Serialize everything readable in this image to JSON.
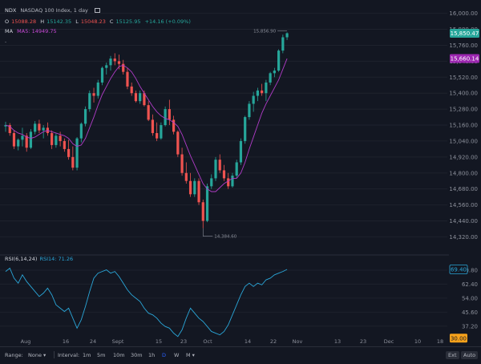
{
  "header": {
    "symbol": "NDX",
    "description": "NASDAQ 100 Index, 1 day",
    "o_label": "O",
    "o_value": "15088.28",
    "h_label": "H",
    "h_value": "15142.35",
    "l_label": "L",
    "l_value": "15048.23",
    "c_label": "C",
    "c_value": "15125.95",
    "change": "+14.16 (+0.09%)",
    "ma_label": "MA",
    "ma_value": "MA5: 14949.75"
  },
  "rsi_legend": {
    "label": "RSI(6,14,24)",
    "value": "RSI14: 71.26"
  },
  "bottom_bar": {
    "range_label": "Range:",
    "range_value": "None",
    "interval_label": "Interval:",
    "intervals": [
      "1m",
      "5m",
      "10m",
      "30m",
      "1h",
      "D",
      "W",
      "M"
    ],
    "active_interval": "D",
    "ext_label": "Ext",
    "auto_label": "Auto"
  },
  "chart_data": {
    "type": "candlestick",
    "price_axis": {
      "ticks": [
        16000,
        15880,
        15760,
        15640,
        15520,
        15400,
        15280,
        15160,
        15040,
        14920,
        14800,
        14680,
        14560,
        14440,
        14320
      ],
      "ylim": [
        14220,
        16040
      ]
    },
    "rsi_axis": {
      "ticks": [
        70.8,
        62.4,
        54,
        45.6,
        37.2
      ],
      "oversold": 30,
      "ylim": [
        27,
        78
      ]
    },
    "price_badges": {
      "last": "15,850.47",
      "ma": "15,660.14"
    },
    "annotations": {
      "high": "15,856.90",
      "low": "14,384.60"
    },
    "x_ticks": [
      "Aug",
      "16",
      "24",
      "Sept",
      "15",
      "23",
      "Oct",
      "14",
      "22",
      "Nov",
      "13",
      "23",
      "Dec",
      "10",
      "18"
    ],
    "candles": [
      [
        15150,
        15185,
        15110,
        15160
      ],
      [
        15160,
        15175,
        15080,
        15100
      ],
      [
        15100,
        15120,
        14980,
        15000
      ],
      [
        15000,
        15060,
        14970,
        15050
      ],
      [
        15050,
        15140,
        15000,
        15080
      ],
      [
        15080,
        15100,
        14960,
        14990
      ],
      [
        14990,
        15130,
        14980,
        15110
      ],
      [
        15110,
        15190,
        15090,
        15170
      ],
      [
        15170,
        15200,
        15100,
        15120
      ],
      [
        15120,
        15160,
        15060,
        15140
      ],
      [
        15140,
        15180,
        15080,
        15100
      ],
      [
        15100,
        15120,
        14980,
        15010
      ],
      [
        15010,
        15100,
        14990,
        15080
      ],
      [
        15080,
        15110,
        15000,
        15040
      ],
      [
        15040,
        15060,
        14960,
        14980
      ],
      [
        14980,
        15050,
        14900,
        14920
      ],
      [
        14920,
        15000,
        14820,
        14840
      ],
      [
        14840,
        15070,
        14820,
        15060
      ],
      [
        15060,
        15180,
        15030,
        15170
      ],
      [
        15170,
        15300,
        15150,
        15280
      ],
      [
        15280,
        15420,
        15260,
        15400
      ],
      [
        15400,
        15440,
        15330,
        15380
      ],
      [
        15380,
        15500,
        15360,
        15480
      ],
      [
        15480,
        15600,
        15460,
        15590
      ],
      [
        15590,
        15630,
        15540,
        15610
      ],
      [
        15610,
        15680,
        15570,
        15660
      ],
      [
        15660,
        15700,
        15610,
        15640
      ],
      [
        15640,
        15690,
        15580,
        15620
      ],
      [
        15620,
        15650,
        15540,
        15560
      ],
      [
        15560,
        15590,
        15430,
        15450
      ],
      [
        15450,
        15480,
        15380,
        15400
      ],
      [
        15400,
        15420,
        15330,
        15340
      ],
      [
        15340,
        15420,
        15320,
        15400
      ],
      [
        15400,
        15420,
        15300,
        15310
      ],
      [
        15310,
        15340,
        15190,
        15200
      ],
      [
        15200,
        15240,
        15080,
        15100
      ],
      [
        15100,
        15180,
        15040,
        15060
      ],
      [
        15060,
        15180,
        15050,
        15160
      ],
      [
        15160,
        15300,
        15150,
        15280
      ],
      [
        15280,
        15350,
        15160,
        15200
      ],
      [
        15200,
        15230,
        15090,
        15110
      ],
      [
        15110,
        15120,
        14920,
        14940
      ],
      [
        14940,
        14990,
        14780,
        14800
      ],
      [
        14800,
        14880,
        14720,
        14740
      ],
      [
        14740,
        14800,
        14620,
        14640
      ],
      [
        14640,
        14760,
        14620,
        14740
      ],
      [
        14740,
        14760,
        14560,
        14580
      ],
      [
        14580,
        14600,
        14384.6,
        14440
      ],
      [
        14440,
        14720,
        14430,
        14700
      ],
      [
        14700,
        14790,
        14680,
        14760
      ],
      [
        14760,
        14920,
        14740,
        14900
      ],
      [
        14900,
        14940,
        14800,
        14820
      ],
      [
        14820,
        14860,
        14740,
        14760
      ],
      [
        14760,
        14800,
        14680,
        14700
      ],
      [
        14700,
        14800,
        14690,
        14780
      ],
      [
        14780,
        14900,
        14760,
        14880
      ],
      [
        14880,
        15060,
        14860,
        15040
      ],
      [
        15040,
        15230,
        15020,
        15220
      ],
      [
        15220,
        15340,
        15200,
        15320
      ],
      [
        15320,
        15410,
        15260,
        15380
      ],
      [
        15380,
        15440,
        15340,
        15420
      ],
      [
        15420,
        15470,
        15380,
        15400
      ],
      [
        15400,
        15500,
        15340,
        15480
      ],
      [
        15480,
        15560,
        15460,
        15550
      ],
      [
        15550,
        15590,
        15520,
        15570
      ],
      [
        15570,
        15730,
        15560,
        15720
      ],
      [
        15720,
        15840,
        15700,
        15820
      ],
      [
        15820,
        15856.9,
        15800,
        15850.47
      ]
    ],
    "ma": [
      15160,
      15150,
      15120,
      15100,
      15090,
      15070,
      15060,
      15070,
      15090,
      15110,
      15120,
      15110,
      15100,
      15090,
      15080,
      15060,
      15020,
      15000,
      15010,
      15060,
      15140,
      15220,
      15310,
      15390,
      15450,
      15510,
      15560,
      15600,
      15610,
      15590,
      15560,
      15510,
      15450,
      15400,
      15350,
      15300,
      15260,
      15230,
      15210,
      15200,
      15180,
      15150,
      15090,
      15010,
      14930,
      14860,
      14790,
      14720,
      14680,
      14660,
      14660,
      14690,
      14720,
      14740,
      14760,
      14760,
      14800,
      14880,
      14980,
      15070,
      15160,
      15250,
      15320,
      15380,
      15440,
      15500,
      15580,
      15660.14
    ],
    "rsi": [
      70,
      72,
      66,
      63,
      68,
      64,
      61,
      58,
      55,
      57,
      60,
      56,
      50,
      48,
      46,
      48,
      42,
      36,
      41,
      49,
      58,
      66,
      69,
      70,
      71,
      69,
      70,
      67,
      63,
      59,
      56,
      54,
      52,
      48,
      45,
      44,
      42,
      39,
      37,
      36,
      33,
      31,
      35,
      42,
      48,
      45,
      42,
      40,
      37,
      34,
      33,
      32,
      34,
      38,
      44,
      50,
      56,
      61,
      63,
      61,
      63,
      62,
      65,
      66,
      68,
      69,
      70,
      71.26
    ]
  }
}
